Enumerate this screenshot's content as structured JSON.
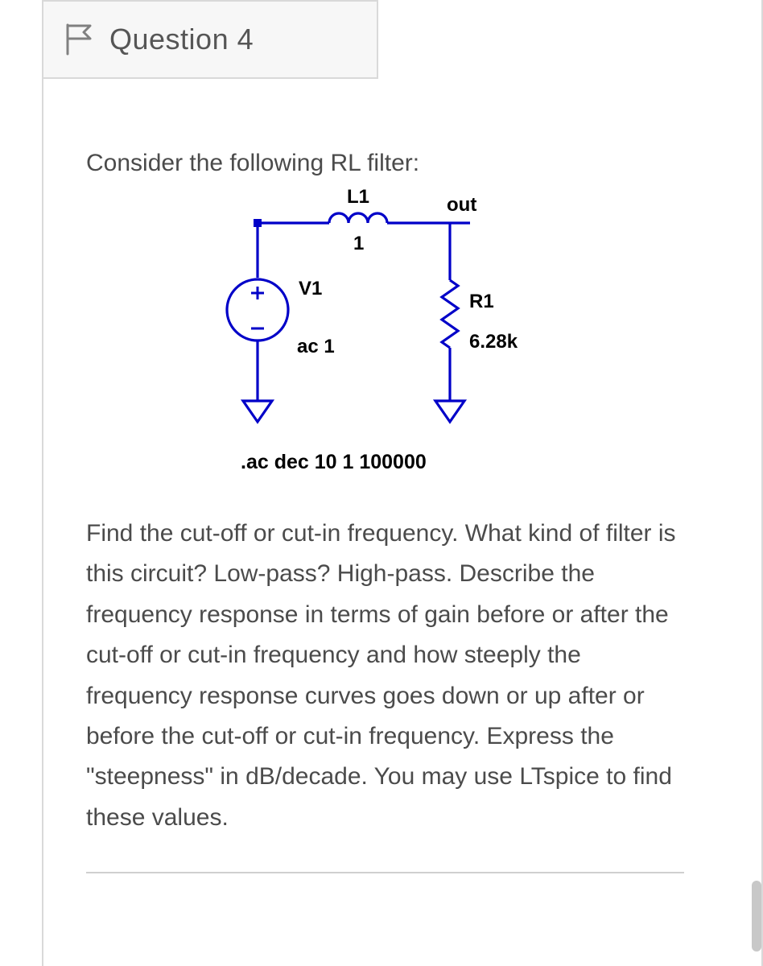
{
  "header": {
    "title": "Question 4"
  },
  "intro": "Consider the following RL filter:",
  "circuit": {
    "L1_label": "L1",
    "L1_value": "1",
    "V1_label": "V1",
    "V1_value": "ac 1",
    "R1_label": "R1",
    "R1_value": "6.28k",
    "out_label": "out",
    "spice_directive": ".ac dec 10 1 100000"
  },
  "prompt": "Find the cut-off or cut-in frequency.  What kind of filter is this circuit?  Low-pass?  High-pass.  Describe the frequency response in terms of gain before or after the cut-off or cut-in frequency and how steeply the frequency response curves goes down or up after or before the cut-off or cut-in frequency.  Express the \"steepness\" in dB/decade. You may use LTspice to find these values."
}
